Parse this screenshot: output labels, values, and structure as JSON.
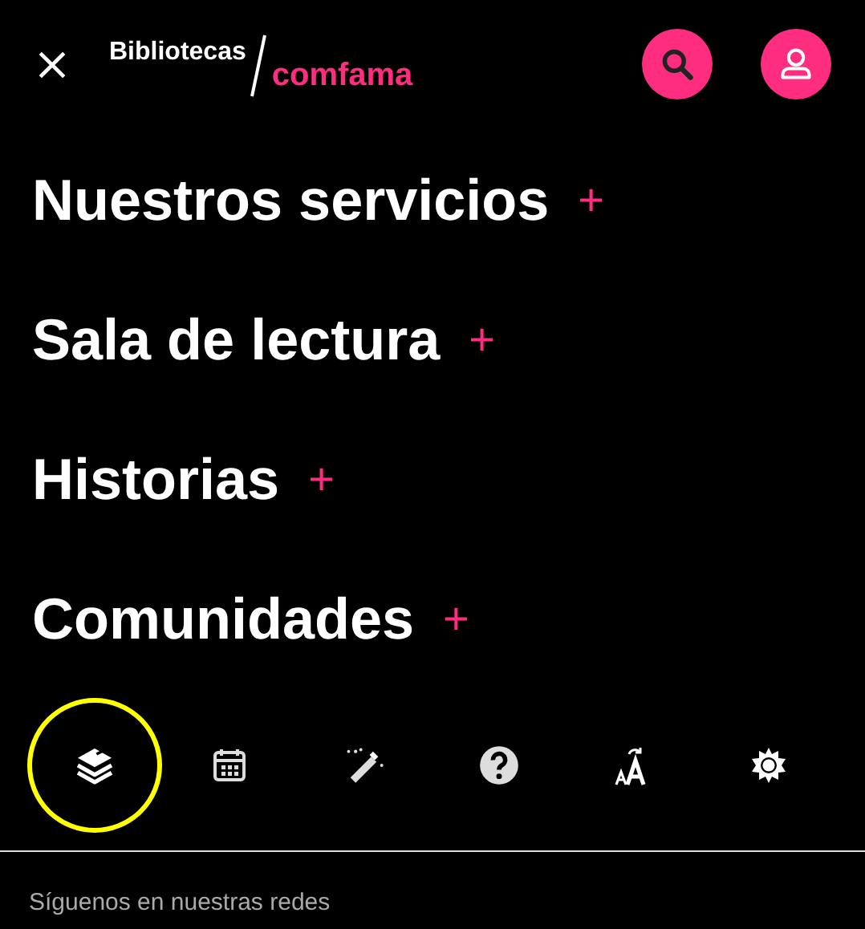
{
  "header": {
    "brand_top": "Bibliotecas",
    "brand_bottom": "comfama"
  },
  "menu": [
    {
      "label": "Nuestros servicios",
      "expander": "+"
    },
    {
      "label": "Sala de lectura",
      "expander": "+"
    },
    {
      "label": "Historias",
      "expander": "+"
    },
    {
      "label": "Comunidades",
      "expander": "+"
    }
  ],
  "tools": [
    {
      "kind": "books",
      "selected": true
    },
    {
      "kind": "calendar",
      "selected": false
    },
    {
      "kind": "wand",
      "selected": false
    },
    {
      "kind": "help",
      "selected": false
    },
    {
      "kind": "text-size",
      "selected": false
    },
    {
      "kind": "brightness",
      "selected": false
    }
  ],
  "footer": {
    "text": "Síguenos en nuestras redes"
  }
}
